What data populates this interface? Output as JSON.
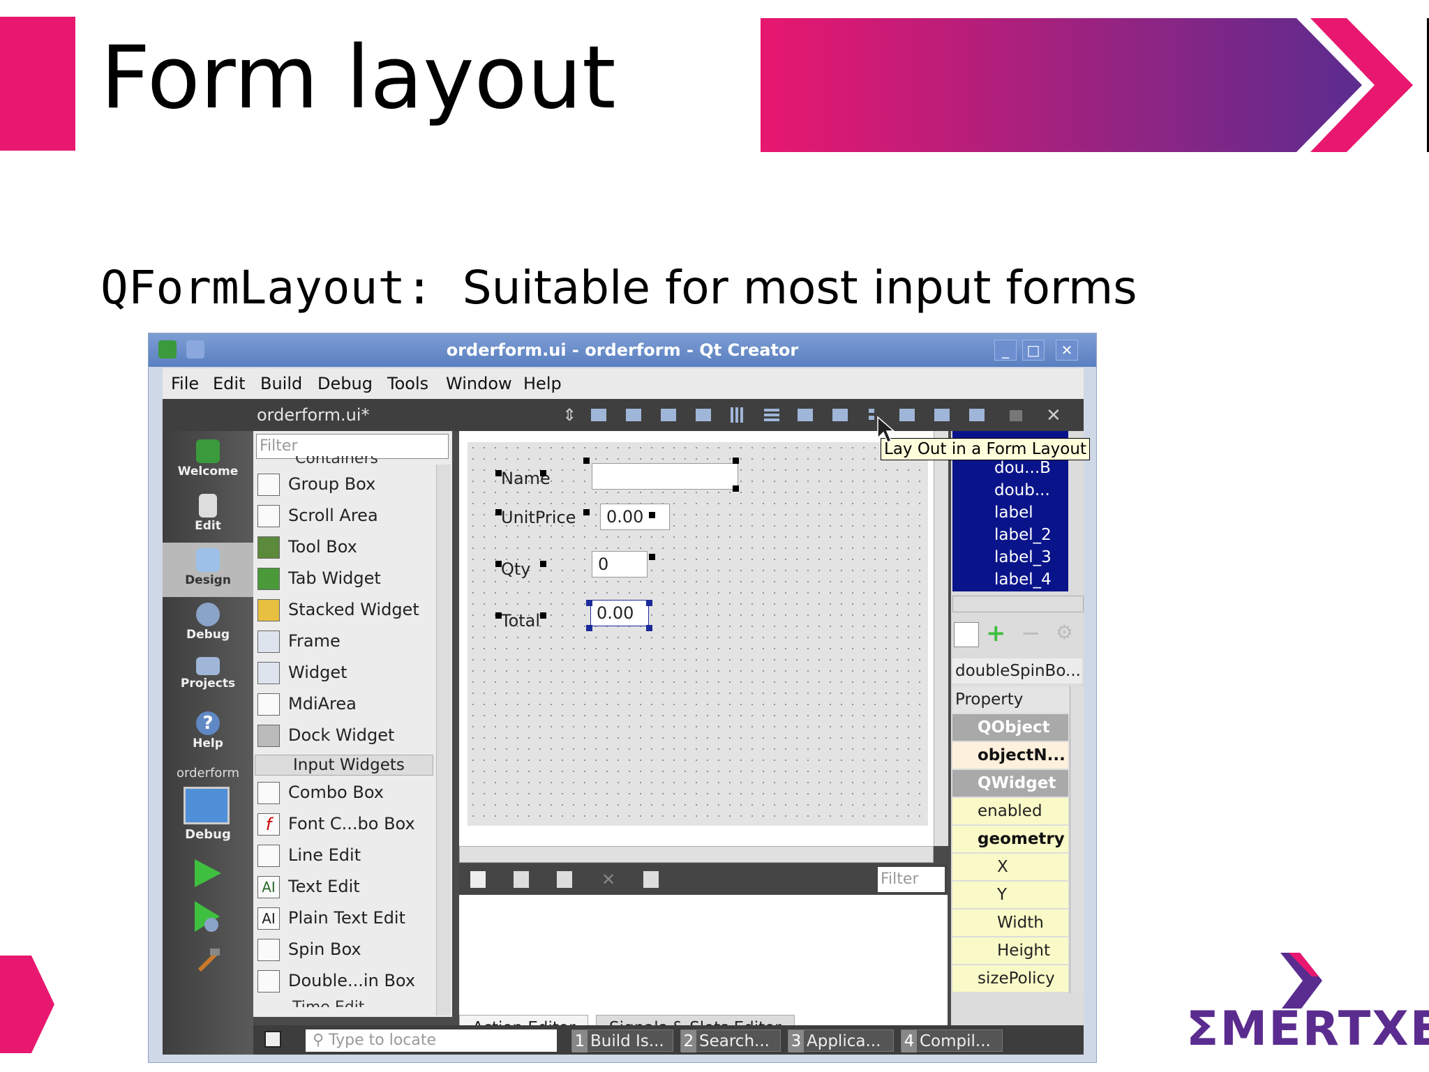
{
  "slide": {
    "title": "Form layout",
    "subtitle_mono": "QFormLayout:",
    "subtitle_text": "Suitable for most input forms",
    "logo_text": "ΣMERTXE",
    "colors": {
      "accent_pink": "#e8176f",
      "accent_purple": "#5b2c8f"
    }
  },
  "window": {
    "title": "orderform.ui - orderform - Qt Creator",
    "controls": {
      "minimize": "_",
      "maximize": "□",
      "close": "✕"
    },
    "menu": [
      "File",
      "Edit",
      "Build",
      "Debug",
      "Tools",
      "Window",
      "Help"
    ],
    "open_file": "orderform.ui*",
    "tooltip": "Lay Out in a Form Layout",
    "modes": [
      {
        "label": "Welcome",
        "icon": "qt-logo-icon"
      },
      {
        "label": "Edit",
        "icon": "document-icon"
      },
      {
        "label": "Design",
        "icon": "design-icon"
      },
      {
        "label": "Debug",
        "icon": "bug-icon"
      },
      {
        "label": "Projects",
        "icon": "folder-icon"
      },
      {
        "label": "Help",
        "icon": "help-icon"
      }
    ],
    "target": {
      "project": "orderform",
      "config": "Debug"
    }
  },
  "widget_box": {
    "filter_placeholder": "Filter",
    "partial_header": "Containers",
    "containers": [
      "Group Box",
      "Scroll Area",
      "Tool Box",
      "Tab Widget",
      "Stacked Widget",
      "Frame",
      "Widget",
      "MdiArea",
      "Dock Widget"
    ],
    "input_category": "Input Widgets",
    "inputs": [
      "Combo Box",
      "Font C...bo Box",
      "Line Edit",
      "Text Edit",
      "Plain Text Edit",
      "Spin Box",
      "Double...in Box"
    ],
    "partial_footer": "Time Edit"
  },
  "form": {
    "fields": [
      {
        "label": "Name",
        "value": ""
      },
      {
        "label": "UnitPrice",
        "value": "0.00"
      },
      {
        "label": "Qty",
        "value": "0"
      },
      {
        "label": "Total",
        "value": "0.00"
      }
    ]
  },
  "action_editor": {
    "filter_placeholder": "Filter",
    "tabs": [
      "Action Editor",
      "Signals & Slots Editor"
    ]
  },
  "object_inspector": {
    "items": [
      "dou...B",
      "doub...",
      "label",
      "label_2",
      "label_3",
      "label_4"
    ]
  },
  "property_editor": {
    "class_name": "doubleSpinBo...",
    "header": "Property",
    "rows": [
      {
        "text": "QObject",
        "kind": "group"
      },
      {
        "text": "objectN...",
        "kind": "bold"
      },
      {
        "text": "QWidget",
        "kind": "group"
      },
      {
        "text": "enabled",
        "kind": "normal"
      },
      {
        "text": "geometry",
        "kind": "bold-expand"
      },
      {
        "text": "X",
        "kind": "sub"
      },
      {
        "text": "Y",
        "kind": "sub"
      },
      {
        "text": "Width",
        "kind": "sub"
      },
      {
        "text": "Height",
        "kind": "sub"
      },
      {
        "text": "sizePolicy",
        "kind": "expand"
      }
    ]
  },
  "status_bar": {
    "locate_placeholder": "Type to locate",
    "panes": [
      {
        "num": "1",
        "label": "Build Is..."
      },
      {
        "num": "2",
        "label": "Search..."
      },
      {
        "num": "3",
        "label": "Applica..."
      },
      {
        "num": "4",
        "label": "Compil..."
      }
    ]
  }
}
